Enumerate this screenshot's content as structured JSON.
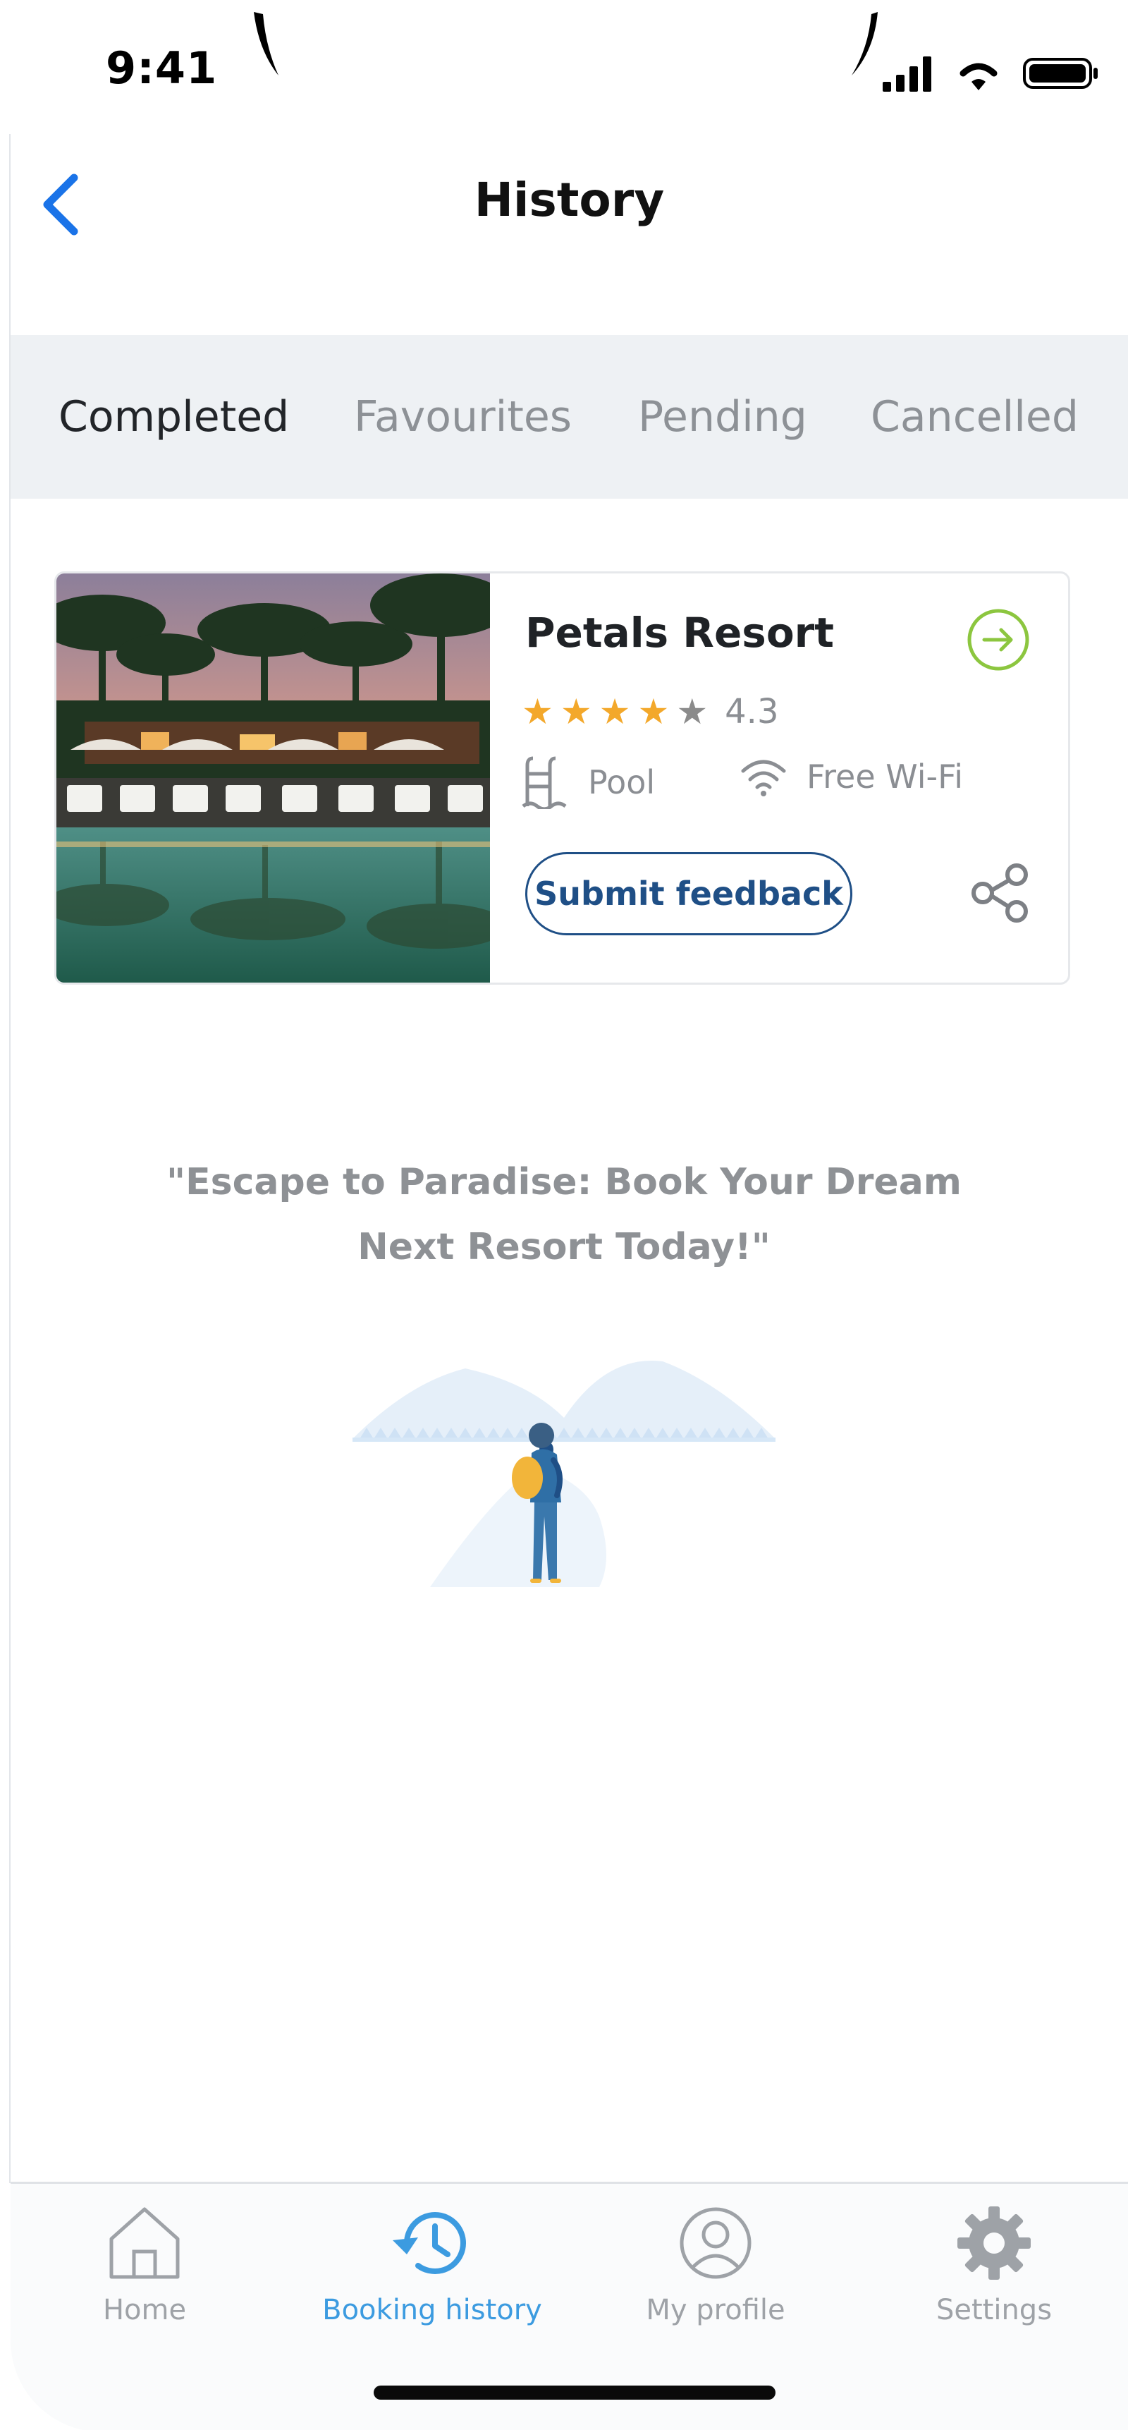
{
  "status_bar": {
    "time": "9:41",
    "icons": [
      "signal-icon",
      "wifi-icon",
      "battery-icon"
    ]
  },
  "header": {
    "title": "History",
    "back_icon": "chevron-left-icon"
  },
  "tabs": [
    {
      "label": "Completed",
      "active": true
    },
    {
      "label": "Favourites",
      "active": false
    },
    {
      "label": "Pending",
      "active": false
    },
    {
      "label": "Cancelled",
      "active": false
    }
  ],
  "booking_card": {
    "name": "Petals Resort",
    "rating": 4.3,
    "rating_text": "4.3",
    "stars_filled": 4,
    "stars_total": 5,
    "amenities": [
      {
        "icon": "pool-ladder-icon",
        "label": "Pool"
      },
      {
        "icon": "wifi-icon",
        "label": "Free Wi-Fi"
      }
    ],
    "feedback_label": "Submit feedback",
    "arrow_icon": "arrow-right-circle-icon",
    "share_icon": "share-icon"
  },
  "promo": {
    "line1": "\"Escape to Paradise: Book Your Dream",
    "line2": "Next Resort Today!\""
  },
  "bottom_nav": [
    {
      "label": "Home",
      "icon": "home-icon",
      "active": false
    },
    {
      "label": "Booking history",
      "icon": "history-icon",
      "active": true
    },
    {
      "label": "My profile",
      "icon": "profile-icon",
      "active": false
    },
    {
      "label": "Settings",
      "icon": "gear-icon",
      "active": false
    }
  ],
  "colors": {
    "accent": "#3c9be0",
    "back_blue": "#1a73e8",
    "star": "#f3a82b",
    "feedback_button": "#1f4f86",
    "arrow_green": "#8cc63f",
    "tab_bar_bg": "#eef1f4"
  }
}
